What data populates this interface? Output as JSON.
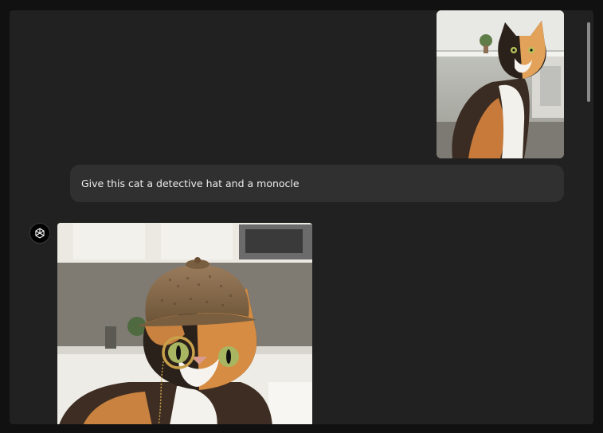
{
  "conversation": {
    "user_message": "Give this cat a detective hat and a monocle",
    "user_image": {
      "icon": "calico-cat-photo",
      "description_hidden": true
    },
    "assistant": {
      "avatar_icon": "openai-logo-icon",
      "generated_image": {
        "icon": "calico-cat-detective-hat-monocle-photo"
      }
    }
  },
  "colors": {
    "window_bg": "#212121",
    "bubble_bg": "#303030",
    "text": "#ececec"
  }
}
